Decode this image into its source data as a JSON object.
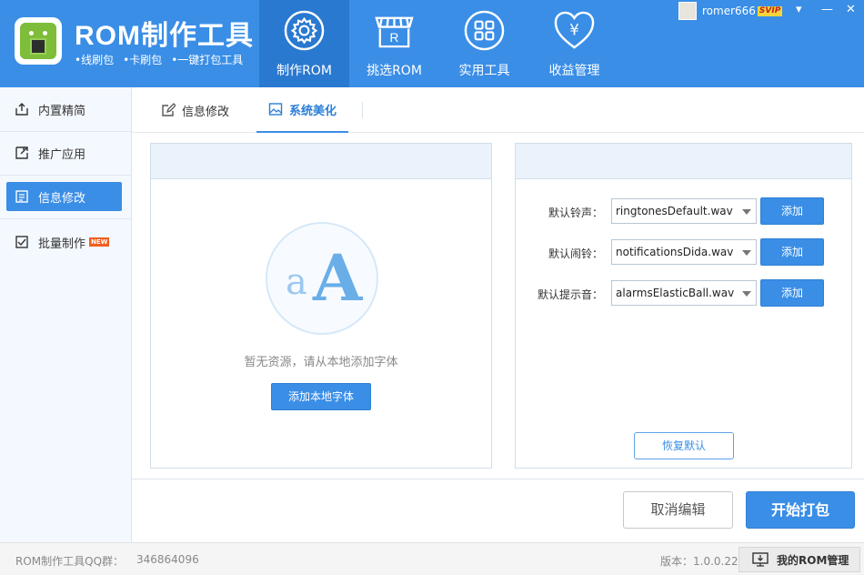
{
  "app": {
    "title": "ROM制作工具",
    "features": [
      "•线刷包",
      "•卡刷包",
      "•一键打包工具"
    ]
  },
  "nav": [
    {
      "label": "制作ROM",
      "icon": "gear-icon",
      "active": true
    },
    {
      "label": "挑选ROM",
      "icon": "store-icon",
      "active": false
    },
    {
      "label": "实用工具",
      "icon": "grid-icon",
      "active": false
    },
    {
      "label": "收益管理",
      "icon": "yen-heart-icon",
      "active": false
    }
  ],
  "user": {
    "name": "romer666",
    "badge": "SVIP"
  },
  "window_controls": {
    "dropdown": "▾",
    "minimize": "—",
    "close": "✕"
  },
  "sidebar": {
    "items": [
      {
        "label": "内置精简",
        "icon": "upload-icon",
        "active": false
      },
      {
        "label": "推广应用",
        "icon": "export-icon",
        "active": false
      },
      {
        "label": "信息修改",
        "icon": "info-icon",
        "active": true
      },
      {
        "label": "批量制作",
        "icon": "batch-icon",
        "active": false,
        "badge": "NEW"
      }
    ]
  },
  "tabs": [
    {
      "label": "信息修改",
      "icon": "edit-icon",
      "active": false
    },
    {
      "label": "系统美化",
      "icon": "image-icon",
      "active": true
    }
  ],
  "font_panel": {
    "empty_text": "暂无资源，请从本地添加字体",
    "add_button": "添加本地字体"
  },
  "sound_panel": {
    "rows": [
      {
        "label": "默认铃声：",
        "value": "ringtonesDefault.wav",
        "button": "添加"
      },
      {
        "label": "默认闹铃：",
        "value": "notificationsDida.wav",
        "button": "添加"
      },
      {
        "label": "默认提示音：",
        "value": "alarmsElasticBall.wav",
        "button": "添加"
      }
    ],
    "restore_button": "恢复默认"
  },
  "actions": {
    "cancel": "取消编辑",
    "pack": "开始打包"
  },
  "status": {
    "qq_label": "ROM制作工具QQ群：",
    "qq_number": "346864096",
    "version": "版本：1.0.0.22",
    "my_rom": "我的ROM管理"
  },
  "colors": {
    "primary": "#3a8ee6",
    "primary_dark": "#2a79d0",
    "badge_orange": "#f25d1e",
    "vip_yellow": "#f5d43a"
  }
}
